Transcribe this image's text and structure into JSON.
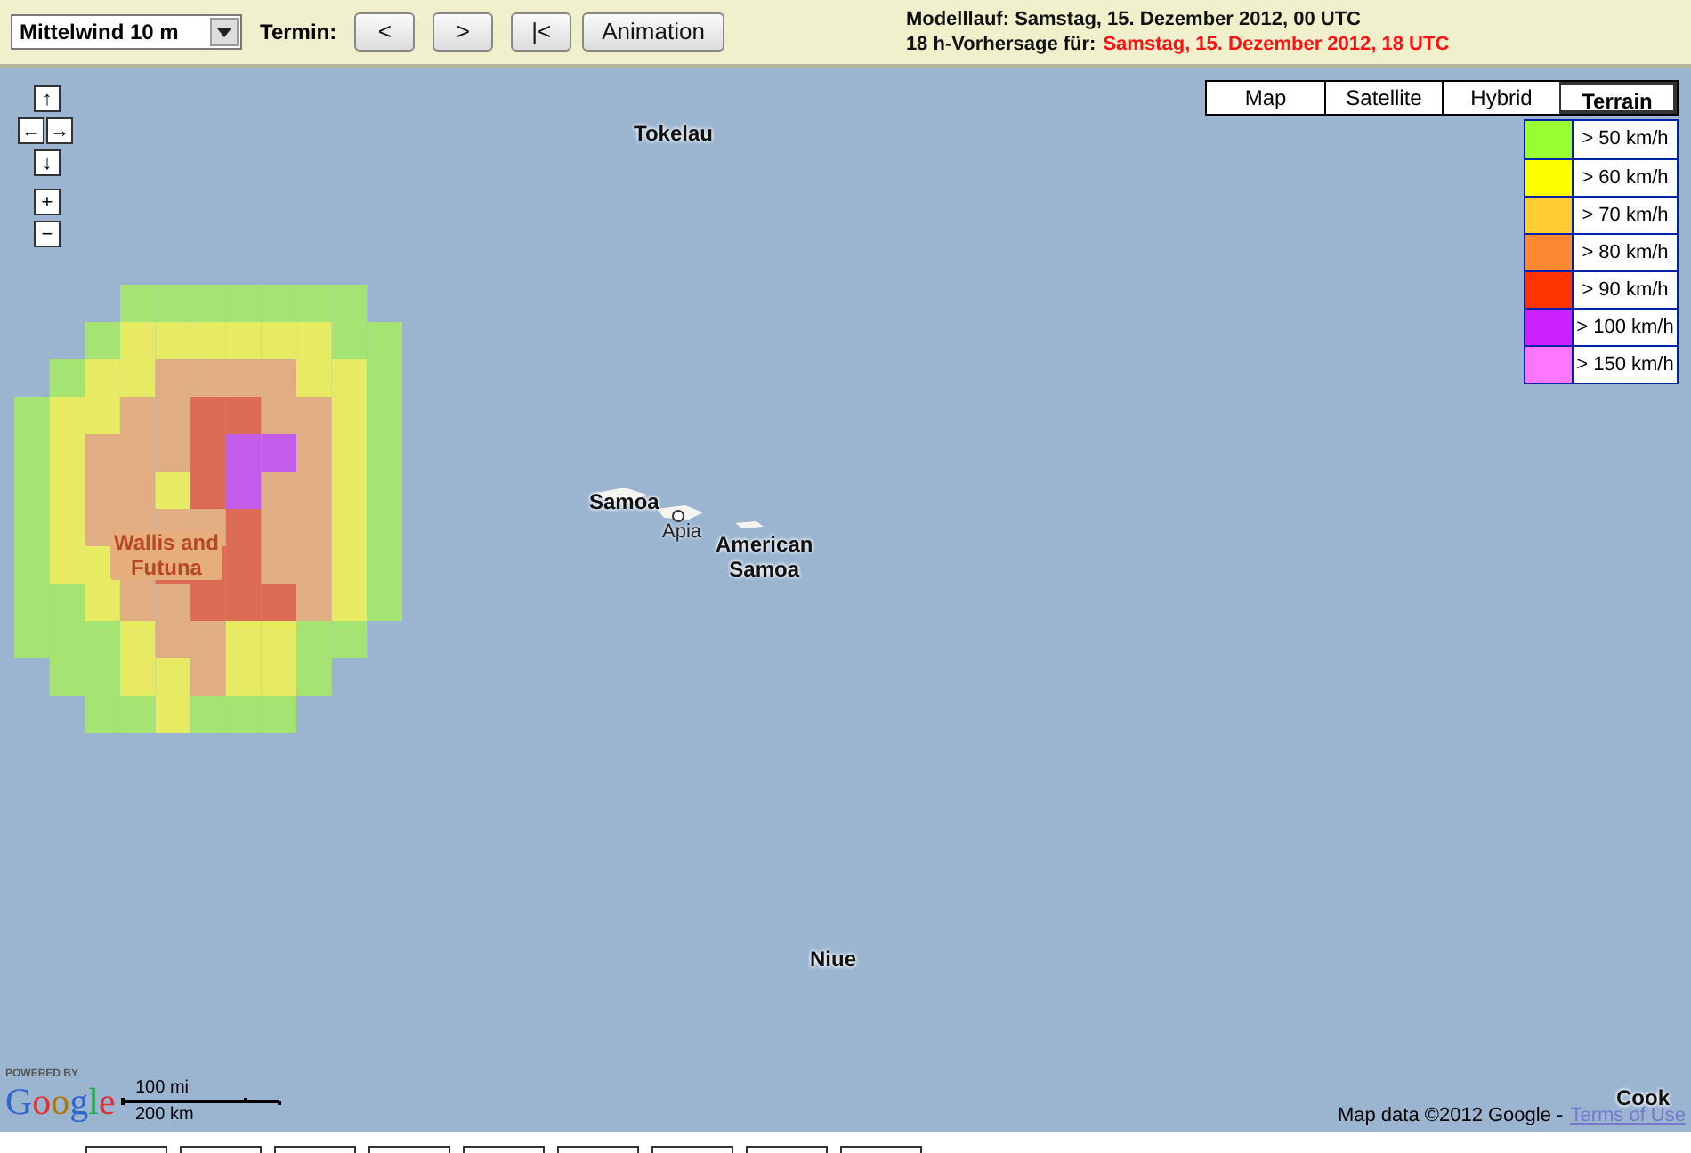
{
  "toolbar": {
    "parameter_select": {
      "value": "Mittelwind 10 m"
    },
    "termin_label": "Termin:",
    "buttons": [
      "<",
      ">",
      "|<",
      "Animation"
    ],
    "run_info": {
      "label": "Modelllauf:",
      "value": "Samstag, 15. Dezember 2012, 00 UTC"
    },
    "forecast_info": {
      "label": "18 h-Vorhersage für:",
      "value": "Samstag, 15. Dezember 2012, 18 UTC"
    }
  },
  "map": {
    "nav_buttons": [
      "↑",
      "←",
      "→",
      "↓",
      "+",
      "−"
    ],
    "map_types": [
      {
        "label": "Map",
        "selected": false
      },
      {
        "label": "Satellite",
        "selected": false
      },
      {
        "label": "Hybrid",
        "selected": false
      },
      {
        "label": "Terrain",
        "selected": true
      }
    ],
    "legend": [
      {
        "label": "> 50 km/h",
        "color": "#99ff33"
      },
      {
        "label": "> 60 km/h",
        "color": "#ffff00"
      },
      {
        "label": "> 70 km/h",
        "color": "#ffcc33"
      },
      {
        "label": "> 80 km/h",
        "color": "#ff8833"
      },
      {
        "label": "> 90 km/h",
        "color": "#ff3300"
      },
      {
        "label": "> 100 km/h",
        "color": "#cc22ff"
      },
      {
        "label": "> 150 km/h",
        "color": "#ff77ff"
      }
    ],
    "places": [
      {
        "name": "Tokelau",
        "kind": "region"
      },
      {
        "name": "Wallis and\nFutuna",
        "kind": "overlay"
      },
      {
        "name": "Samoa",
        "kind": "region"
      },
      {
        "name": "Apia",
        "kind": "city"
      },
      {
        "name": "American\nSamoa",
        "kind": "region"
      },
      {
        "name": "Niue",
        "kind": "region"
      },
      {
        "name": "Cook",
        "kind": "region"
      }
    ],
    "logo": {
      "powered_by": "POWERED BY",
      "letters": [
        {
          "text": "G",
          "color": "#3366cc"
        },
        {
          "text": "o",
          "color": "#dd3333"
        },
        {
          "text": "o",
          "color": "#b07800"
        },
        {
          "text": "g",
          "color": "#3366cc"
        },
        {
          "text": "l",
          "color": "#22aa44"
        },
        {
          "text": "e",
          "color": "#dd3333"
        }
      ]
    },
    "scale": {
      "miles": "100 mi",
      "km": "200 km"
    },
    "attribution": {
      "text": "Map data ©2012 Google -",
      "link": "Terms of Use"
    }
  }
}
